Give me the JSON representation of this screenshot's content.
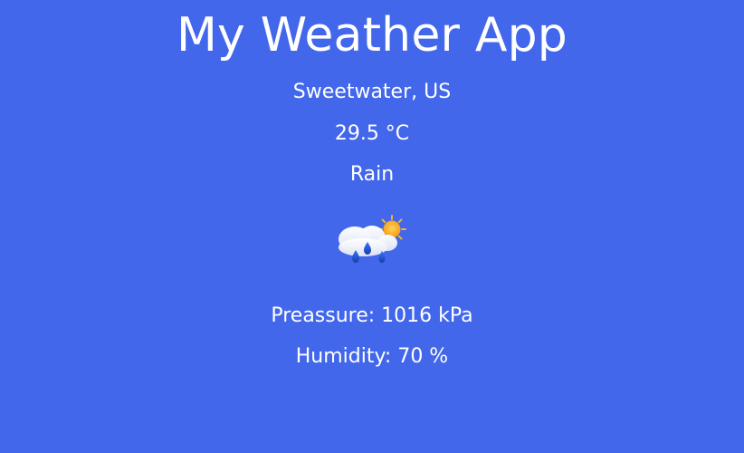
{
  "app": {
    "title": "My Weather App"
  },
  "weather": {
    "location": "Sweetwater, US",
    "temperature": "29.5 °C",
    "description": "Rain",
    "icon": "rain-sun-cloud-icon",
    "pressure_text": "Preassure: 1016 kPa",
    "humidity_text": "Humidity: 70 %"
  },
  "colors": {
    "background": "#4267eb",
    "text": "#ffffff",
    "sun": "#f5a11a",
    "rain": "#1d3fbf"
  }
}
